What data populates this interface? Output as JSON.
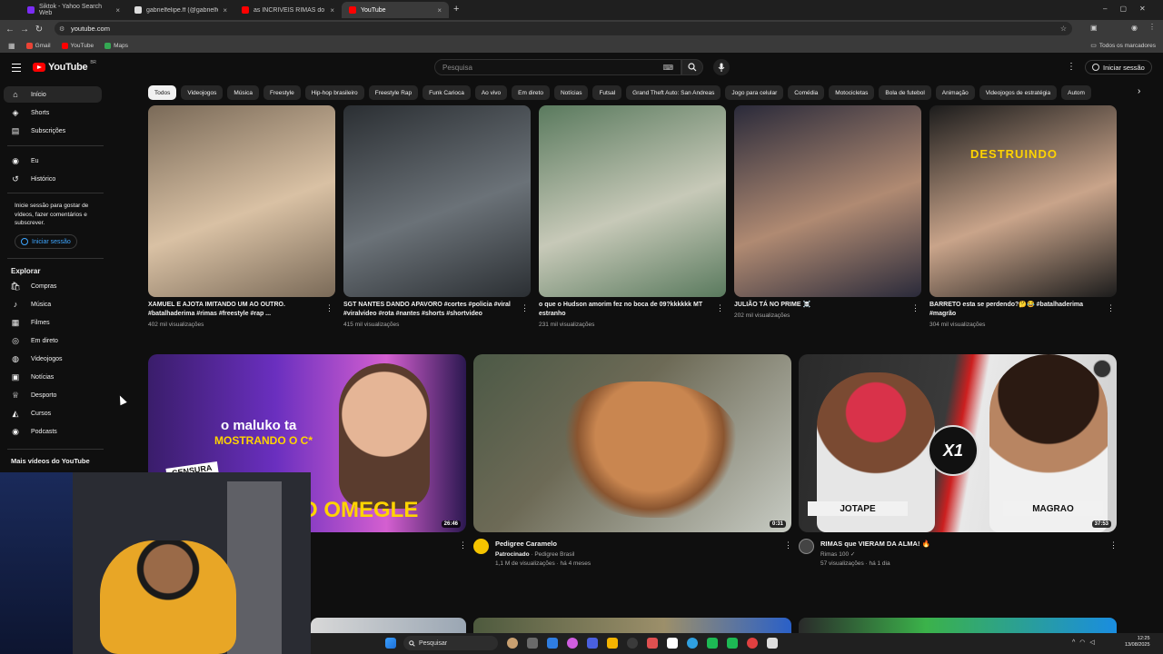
{
  "browser": {
    "tabs": [
      {
        "title": "Siktok - Yahoo Search Web",
        "favicon_color": "#7b2cf5"
      },
      {
        "title": "gabrielfelipe.ff (@gabrielfelipe...",
        "favicon_color": "#ffffff"
      },
      {
        "title": "as INCRÍVEIS RIMAS do GURI c...",
        "favicon_color": "#ff0000"
      },
      {
        "title": "YouTube",
        "favicon_color": "#ff0000"
      }
    ],
    "new_tab": "+",
    "url": "youtube.com",
    "bookmarks": [
      {
        "label": "Gmail",
        "color": "#ea4335"
      },
      {
        "label": "YouTube",
        "color": "#ff0000"
      },
      {
        "label": "Maps",
        "color": "#34a853"
      }
    ],
    "all_bookmarks": "Todos os marcadores"
  },
  "header": {
    "logo_text": "YouTube",
    "region": "BR",
    "search_placeholder": "Pesquisa",
    "signin_label": "Iniciar sessão"
  },
  "sidebar": {
    "main_items": [
      {
        "label": "Início",
        "icon": "home-icon",
        "glyph": "⌂"
      },
      {
        "label": "Shorts",
        "icon": "shorts-icon",
        "glyph": "◈"
      },
      {
        "label": "Subscrições",
        "icon": "subscriptions-icon",
        "glyph": "▤"
      }
    ],
    "you_items": [
      {
        "label": "Eu",
        "icon": "you-icon",
        "glyph": "◉"
      },
      {
        "label": "Histórico",
        "icon": "history-icon",
        "glyph": "↺"
      }
    ],
    "signin_text": "Inicie sessão para gostar de vídeos, fazer comentários e subscrever.",
    "signin_button": "Iniciar sessão",
    "explore_title": "Explorar",
    "explore_items": [
      {
        "label": "Compras",
        "icon": "shopping-icon",
        "glyph": "🛍"
      },
      {
        "label": "Música",
        "icon": "music-icon",
        "glyph": "♪"
      },
      {
        "label": "Filmes",
        "icon": "movies-icon",
        "glyph": "▦"
      },
      {
        "label": "Em direto",
        "icon": "live-icon",
        "glyph": "◎"
      },
      {
        "label": "Videojogos",
        "icon": "gaming-icon",
        "glyph": "◍"
      },
      {
        "label": "Notícias",
        "icon": "news-icon",
        "glyph": "▣"
      },
      {
        "label": "Desporto",
        "icon": "sports-icon",
        "glyph": "♕"
      },
      {
        "label": "Cursos",
        "icon": "courses-icon",
        "glyph": "◭"
      },
      {
        "label": "Podcasts",
        "icon": "podcasts-icon",
        "glyph": "◉"
      }
    ],
    "more_title": "Mais vídeos do YouTube"
  },
  "chips": [
    "Todos",
    "Videojogos",
    "Música",
    "Freestyle",
    "Hip-hop brasileiro",
    "Freestyle Rap",
    "Funk Carioca",
    "Ao vivo",
    "Em direto",
    "Notícias",
    "Futsal",
    "Grand Theft Auto: San Andreas",
    "Jogo para celular",
    "Comédia",
    "Motocicletas",
    "Bola de futebol",
    "Animação",
    "Videojogos de estratégia",
    "Autom"
  ],
  "shorts": [
    {
      "title": "XAMUEL E AJOTA IMITANDO UM AO OUTRO. #batalhaderima #rimas #freestyle #rap ...",
      "views": "402 mil visualizações",
      "c1": "#7a6a58",
      "c2": "#d9c1a4"
    },
    {
      "title": "SGT NANTES DANDO APAVORO #cortes #policia #viral #viralvideo #rota #nantes #shorts #shortvideo",
      "views": "415 mil visualizações",
      "c1": "#2b2f33",
      "c2": "#6b7278"
    },
    {
      "title": "o que o Hudson amorim fez no boca de 09?kkkkkk MT estranho",
      "views": "231 mil visualizações",
      "c1": "#5a7a5e",
      "c2": "#c7c9b8"
    },
    {
      "title": "JULIÃO TÁ NO PRIME ☠️",
      "views": "202 mil visualizações",
      "c1": "#2a2a3a",
      "c2": "#b08a72"
    },
    {
      "title": "BARRETO esta se perdendo?🤔😂 #batalhaderima #magrão",
      "views": "304 mil visualizações",
      "c1": "#1c1c1c",
      "c2": "#c9a48a",
      "overlay": "DESTRUINDO"
    }
  ],
  "videos": [
    {
      "overlay_top": "o maluko ta",
      "overlay_mid": "MOSTRANDO O C*",
      "overlay_big": "O OMEGLE",
      "censura": "CENSURA",
      "duration": "26:46",
      "c1": "#6a2fbf",
      "c2": "#d45fd0"
    },
    {
      "title": "Pedigree Caramelo",
      "sponsored": "Patrocinado",
      "sponsor": "· Pedigree Brasil",
      "meta": "1,1 M de visualizações · há 4 meses",
      "duration": "0:31",
      "c1": "#3c4a3a",
      "c2": "#b77a44",
      "avatar_color": "#f5c400"
    },
    {
      "title": "RIMAS que VIERAM DA ALMA! 🔥",
      "channel": "Rimas 100 ✓",
      "meta": "57 visualizações · há 1 dia",
      "duration": "37:53",
      "c1": "#222222",
      "c2": "#a33",
      "avatar_color": "#444444",
      "badge": "X1",
      "left_tag": "JOTAPE",
      "right_tag": "MAGRAO"
    }
  ],
  "taskbar": {
    "search_label": "Pesquisar",
    "time": "12:25",
    "date": "13/08/2025"
  }
}
